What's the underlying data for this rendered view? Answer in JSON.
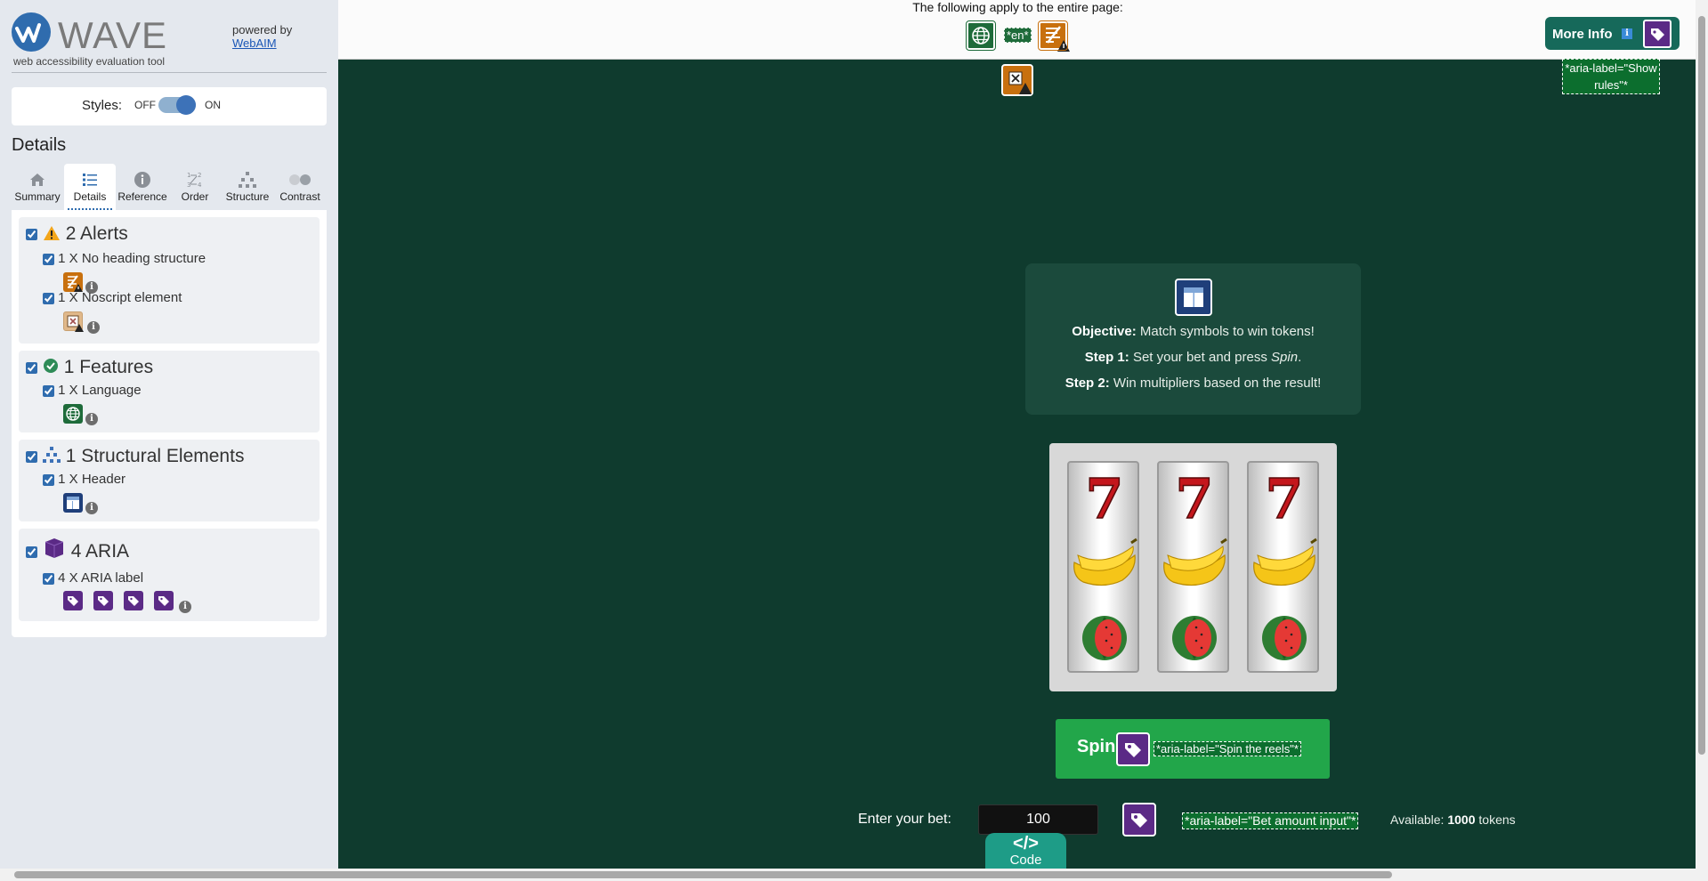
{
  "sidebar": {
    "brand": {
      "word": "WAVE",
      "subtitle": "web accessibility evaluation tool",
      "powered_by": "powered by",
      "powered_link": "WebAIM"
    },
    "styles": {
      "label": "Styles:",
      "off": "OFF",
      "on": "ON",
      "enabled": true
    },
    "details_title": "Details",
    "tabs": [
      {
        "label": "Summary",
        "icon": "home-icon"
      },
      {
        "label": "Details",
        "icon": "list-icon",
        "active": true
      },
      {
        "label": "Reference",
        "icon": "info-icon"
      },
      {
        "label": "Order",
        "icon": "order-icon"
      },
      {
        "label": "Structure",
        "icon": "hierarchy-icon"
      },
      {
        "label": "Contrast",
        "icon": "contrast-icon"
      }
    ],
    "groups": {
      "alerts": {
        "title": "2 Alerts",
        "items": [
          {
            "label": "1 X No heading structure"
          },
          {
            "label": "1 X Noscript element"
          }
        ]
      },
      "features": {
        "title": "1 Features",
        "items": [
          {
            "label": "1 X Language"
          }
        ]
      },
      "structure": {
        "title": "1 Structural Elements",
        "items": [
          {
            "label": "1 X Header"
          }
        ]
      },
      "aria": {
        "title": "4 ARIA",
        "items": [
          {
            "label": "4 X ARIA label"
          }
        ]
      }
    },
    "info_glyph": "i"
  },
  "topbar": {
    "applies_text": "The following apply to the entire page:",
    "lang_code": "*en*",
    "more_info": "More Info",
    "more_info_badge": "i"
  },
  "aria_labels": {
    "show_rules": "*aria-label=\"Show rules\"*",
    "spin": "*aria-label=\"Spin the reels\"*",
    "bet": "*aria-label=\"Bet amount input\"*"
  },
  "game": {
    "objective_label": "Objective:",
    "objective_text": "Match symbols to win tokens!",
    "step1_label": "Step 1:",
    "step1_text_a": "Set your bet and press ",
    "step1_text_em": "Spin",
    "step1_text_b": ".",
    "step2_label": "Step 2:",
    "step2_text": "Win multipliers based on the result!",
    "reel_symbols": [
      "seven",
      "banana",
      "watermelon"
    ],
    "spin_label": "Spin",
    "bet_label": "Enter your bet:",
    "bet_value": "100",
    "available_label": "Available:",
    "available_value": "1000",
    "available_unit": "tokens"
  },
  "code_tab": {
    "symbol": "</>",
    "label": "Code"
  },
  "colors": {
    "accent": "#2f6cae",
    "page_bg": "#0f3b2e",
    "spin": "#22a64a",
    "aria": "#5b2a86",
    "alert": "#c8700e",
    "feature": "#1e6b3a"
  }
}
